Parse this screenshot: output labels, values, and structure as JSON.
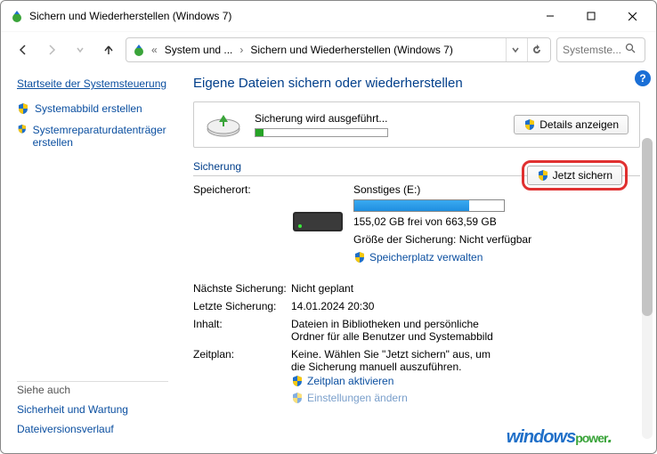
{
  "title": "Sichern und Wiederherstellen (Windows 7)",
  "address": {
    "crumb1": "System und ...",
    "crumb2": "Sichern und Wiederherstellen (Windows 7)"
  },
  "search": {
    "placeholder": "Systemste..."
  },
  "sidebar": {
    "home": "Startseite der Systemsteuerung",
    "items": [
      {
        "label": "Systemabbild erstellen"
      },
      {
        "label": "Systemreparaturdatenträger erstellen"
      }
    ],
    "see_also_label": "Siehe auch",
    "see_also": [
      {
        "label": "Sicherheit und Wartung"
      },
      {
        "label": "Dateiversionsverlauf"
      }
    ]
  },
  "main": {
    "heading": "Eigene Dateien sichern oder wiederherstellen",
    "status": {
      "text": "Sicherung wird ausgeführt...",
      "details_button": "Details anzeigen"
    },
    "sections": {
      "backup": {
        "title": "Sicherung",
        "location_label": "Speicherort:",
        "location_value": "Sonstiges (E:)",
        "disk_free": "155,02 GB frei von 663,59 GB",
        "size_label": "Größe der Sicherung: Nicht verfügbar",
        "manage_space": "Speicherplatz verwalten",
        "now_button": "Jetzt sichern",
        "rows": [
          {
            "k": "Nächste Sicherung:",
            "v": "Nicht geplant"
          },
          {
            "k": "Letzte Sicherung:",
            "v": "14.01.2024 20:30"
          },
          {
            "k": "Inhalt:",
            "v": "Dateien in Bibliotheken und persönliche Ordner für alle Benutzer und Systemabbild"
          },
          {
            "k": "Zeitplan:",
            "v": "Keine. Wählen Sie \"Jetzt sichern\" aus, um die Sicherung manuell auszuführen."
          }
        ],
        "schedule_link": "Zeitplan aktivieren",
        "settings_link": "Einstellungen ändern"
      }
    }
  }
}
